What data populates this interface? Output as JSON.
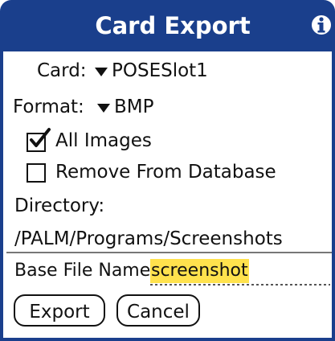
{
  "dialog": {
    "title": "Card Export",
    "info_icon": "info-icon"
  },
  "card": {
    "label": "Card:",
    "value": "POSESlot1",
    "icon": "dropdown-triangle-icon"
  },
  "format": {
    "label": "Format:",
    "value": "BMP",
    "icon": "dropdown-triangle-icon"
  },
  "options": {
    "all_images": {
      "label": "All Images",
      "checked": true
    },
    "remove_from_database": {
      "label": "Remove From Database",
      "checked": false
    }
  },
  "directory": {
    "label": "Directory:",
    "value": "/PALM/Programs/Screenshots"
  },
  "base_file_name": {
    "label": "Base File Name:",
    "value": "screenshot"
  },
  "buttons": {
    "export": "Export",
    "cancel": "Cancel"
  },
  "colors": {
    "title_bar": "#1a3f8c",
    "input_highlight": "#ffe24d"
  }
}
